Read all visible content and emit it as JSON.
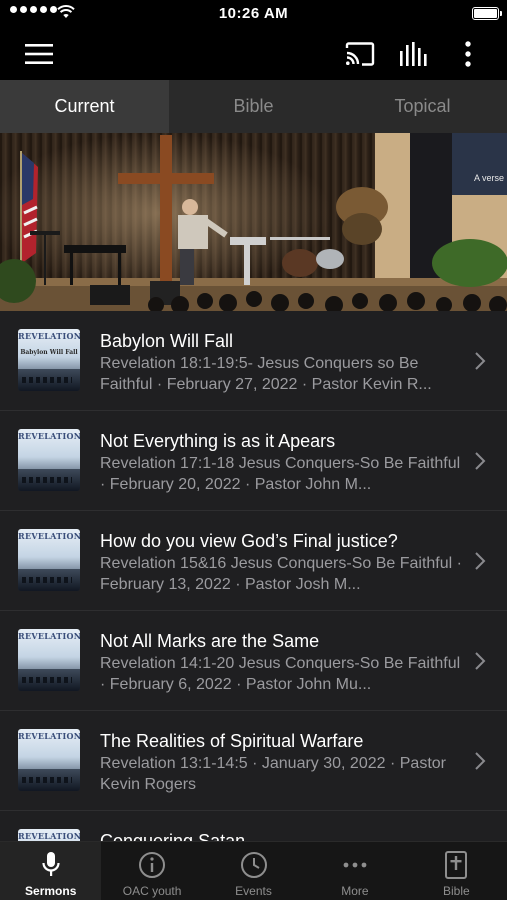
{
  "status_bar": {
    "time": "10:26 AM"
  },
  "app_bar": {
    "icons": [
      "menu-icon",
      "cast-icon",
      "audio-bars-icon",
      "more-vertical-icon"
    ]
  },
  "tabs": [
    {
      "label": "Current",
      "active": true
    },
    {
      "label": "Bible",
      "active": false
    },
    {
      "label": "Topical",
      "active": false
    }
  ],
  "hero": {
    "screen_text": "A verse"
  },
  "sermons": [
    {
      "title": "Babylon Will Fall",
      "subtitle": "Revelation 18:1-19:5- Jesus Conquers so Be Faithful · February 27, 2022 · Pastor Kevin R...",
      "thumb_title": "REVELATION",
      "thumb_sub": "Babylon Will Fall"
    },
    {
      "title": "Not Everything is as it Apears",
      "subtitle": "Revelation 17:1-18 Jesus Conquers-So Be Faithful · February 20, 2022 · Pastor John M...",
      "thumb_title": "REVELATION",
      "thumb_sub": ""
    },
    {
      "title": "How do you view God’s Final justice?",
      "subtitle": "Revelation 15&16 Jesus Conquers-So Be Faithful · February 13, 2022 · Pastor Josh M...",
      "thumb_title": "REVELATION",
      "thumb_sub": ""
    },
    {
      "title": "Not All Marks are the Same",
      "subtitle": "Revelation 14:1-20 Jesus Conquers-So Be Faithful · February 6, 2022 · Pastor John Mu...",
      "thumb_title": "REVELATION",
      "thumb_sub": ""
    },
    {
      "title": "The Realities of Spiritual Warfare",
      "subtitle": "Revelation 13:1-14:5 · January 30, 2022 · Pastor Kevin Rogers",
      "thumb_title": "REVELATION",
      "thumb_sub": ""
    },
    {
      "title": "Conquering Satan",
      "subtitle": "",
      "thumb_title": "REVELATION",
      "thumb_sub": ""
    }
  ],
  "bottom_nav": [
    {
      "label": "Sermons",
      "icon": "microphone-icon",
      "active": true
    },
    {
      "label": "OAC youth",
      "icon": "info-icon",
      "active": false
    },
    {
      "label": "Events",
      "icon": "clock-icon",
      "active": false
    },
    {
      "label": "More",
      "icon": "more-horizontal-icon",
      "active": false
    },
    {
      "label": "Bible",
      "icon": "bible-icon",
      "active": false
    }
  ],
  "colors": {
    "background": "#000000",
    "list_background": "#1f1f21",
    "tab_active": "#3a3a3a",
    "tab_bar": "#2a2a2a",
    "muted_text": "#9b9b9f"
  }
}
